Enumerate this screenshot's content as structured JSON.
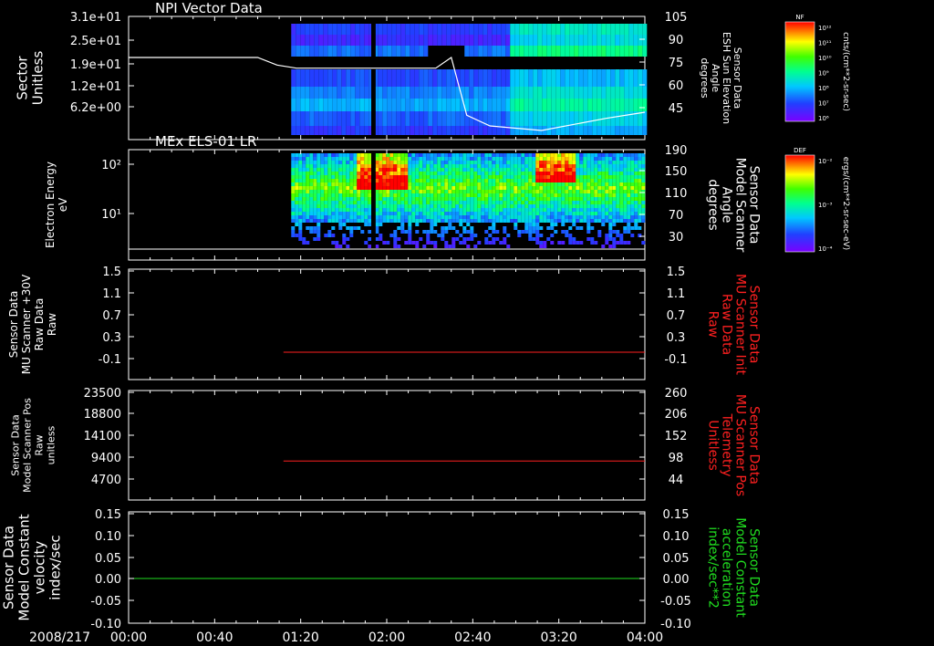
{
  "date_label": "2008/217",
  "time_ticks": [
    "00:00",
    "00:40",
    "01:20",
    "02:00",
    "02:40",
    "03:20",
    "04:00"
  ],
  "colors": {
    "red": "#ff2020",
    "green": "#20dd20",
    "white": "#ffffff"
  },
  "chart_data": [
    {
      "type": "heatmap",
      "title": "NPI Vector Data",
      "ylabel": [
        "Sector",
        "Unitless"
      ],
      "left_ticks": [
        "3.1e+01",
        "2.5e+01",
        "1.9e+01",
        "1.2e+01",
        "6.2e+00"
      ],
      "right_label": [
        "Sensor Data",
        "ESH Sun Elevation",
        "Angle",
        "degrees"
      ],
      "right_ticks": [
        "105",
        "90",
        "75",
        "60",
        "45"
      ],
      "overlay_line": {
        "name": "ESH Sun Elevation Angle",
        "x_hours": [
          0,
          1.0,
          1.15,
          1.3,
          2.2,
          2.38,
          2.5,
          2.62,
          2.8,
          3.2,
          3.7,
          4.0
        ],
        "y_deg": [
          78,
          78,
          73,
          71,
          71,
          71,
          78,
          40,
          33,
          30,
          38,
          42
        ]
      },
      "data_gap_hours": [
        1.88,
        1.9
      ],
      "data_start_hours": 1.26
    },
    {
      "type": "heatmap",
      "title": "MEx ELS-01 LR",
      "ylabel": [
        "Electron Energy",
        "eV"
      ],
      "left_ticks": [
        "10²",
        "10¹"
      ],
      "right_label": [
        "Sensor Data",
        "Model Scanner",
        "Angle",
        "degrees"
      ],
      "right_ticks": [
        "190",
        "150",
        "110",
        "70",
        "30"
      ],
      "overlay_line": {
        "name": "Model Scanner Angle",
        "x_hours": [
          0,
          4.0
        ],
        "y_deg": [
          10,
          10
        ]
      },
      "data_gap_hours": [
        1.88,
        1.9
      ],
      "data_start_hours": 1.26
    },
    {
      "type": "line",
      "title": "",
      "ylabel": [
        "Sensor Data",
        "MU Scanner +30V",
        "Raw Data",
        "Raw"
      ],
      "left_ticks": [
        "1.5",
        "1.1",
        "0.7",
        "0.3",
        "-0.1"
      ],
      "right_label": [
        "Sensor Data",
        "MU Scanner Init",
        "Raw Data",
        "Raw"
      ],
      "right_ticks": [
        "1.5",
        "1.1",
        "0.7",
        "0.3",
        "-0.1"
      ],
      "series": [
        {
          "name": "MU Scanner Init",
          "x_hours": [
            1.2,
            4.0
          ],
          "values": [
            0,
            0
          ]
        }
      ],
      "ylim": [
        -0.3,
        1.5
      ]
    },
    {
      "type": "line",
      "title": "",
      "ylabel": [
        "Sensor Data",
        "Model Scanner Pos",
        "Raw",
        "unitless"
      ],
      "left_ticks": [
        "23500",
        "18800",
        "14100",
        "9400",
        "4700"
      ],
      "right_label": [
        "Sensor Data",
        "MU Scanner Pos",
        "Telemetry",
        "Unitless"
      ],
      "right_ticks": [
        "260",
        "206",
        "152",
        "98",
        "44"
      ],
      "series": [
        {
          "name": "MU Scanner Pos",
          "x_hours": [
            1.2,
            4.0
          ],
          "values": [
            89,
            89
          ]
        }
      ],
      "ylim": [
        0,
        260
      ]
    },
    {
      "type": "line",
      "title": "",
      "ylabel": [
        "Sensor Data",
        "Model Constant",
        "velocity",
        "index/sec"
      ],
      "left_ticks": [
        "0.15",
        "0.10",
        "0.05",
        "0.00",
        "-0.05",
        "-0.10"
      ],
      "right_label": [
        "Sensor Data",
        "Model Constant",
        "acceleration",
        "index/sec**2"
      ],
      "right_ticks": [
        "0.15",
        "0.10",
        "0.05",
        "0.00",
        "-0.05",
        "-0.10"
      ],
      "series": [
        {
          "name": "Model Constant acceleration",
          "x_hours": [
            0,
            4.0
          ],
          "values": [
            0,
            0
          ]
        }
      ],
      "ylim": [
        -0.1,
        0.15
      ]
    }
  ],
  "colorbars": [
    {
      "label": "NF",
      "unit": "cnts/(cm**2-sr-sec)",
      "ticks": [
        "10¹²",
        "10¹¹",
        "10¹⁰",
        "10⁹",
        "10⁸",
        "10⁷",
        "10⁶"
      ]
    },
    {
      "label": "DEF",
      "unit": "ergs/(cm**2-sr-sec-eV)",
      "ticks": [
        "10⁻²",
        "10⁻³",
        "10⁻⁴"
      ]
    }
  ]
}
